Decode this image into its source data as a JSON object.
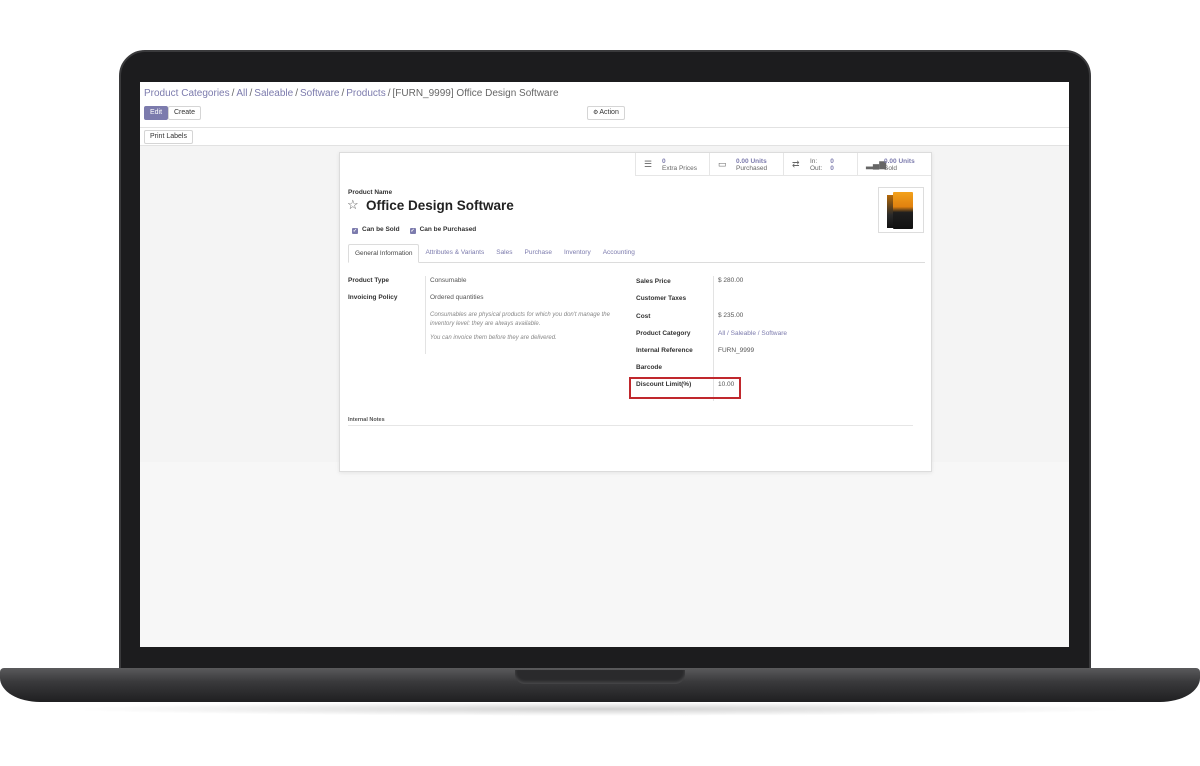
{
  "breadcrumb": {
    "items": [
      "Product Categories",
      "All",
      "Saleable",
      "Software",
      "Products"
    ],
    "separator": "/",
    "current": "[FURN_9999] Office Design Software"
  },
  "toolbar": {
    "edit_label": "Edit",
    "create_label": "Create",
    "action_label": "Action",
    "print_labels": "Print Labels"
  },
  "stat_buttons": {
    "extra_prices": {
      "value": "0",
      "label": "Extra Prices",
      "icon": "list-icon"
    },
    "purchased": {
      "value": "0.00 Units",
      "label": "Purchased",
      "icon": "credit-card-icon"
    },
    "in_out": {
      "in_label": "In:",
      "in_value": "0",
      "out_label": "Out:",
      "out_value": "0",
      "icon": "exchange-icon"
    },
    "sold": {
      "value": "0.00 Units",
      "label": "Sold",
      "icon": "signal-icon"
    }
  },
  "product": {
    "name_label": "Product Name",
    "name": "Office Design Software",
    "can_be_sold": "Can be Sold",
    "can_be_purchased": "Can be Purchased"
  },
  "tabs": [
    "General Information",
    "Attributes & Variants",
    "Sales",
    "Purchase",
    "Inventory",
    "Accounting"
  ],
  "left_fields": {
    "product_type_label": "Product Type",
    "product_type": "Consumable",
    "invoicing_policy_label": "Invoicing Policy",
    "invoicing_policy": "Ordered quantities",
    "help_1": "Consumables are physical products for which you don't manage the inventory level: they are always available.",
    "help_2": "You can invoice them before they are delivered."
  },
  "right_fields": {
    "sales_price_label": "Sales Price",
    "sales_price": "$ 280.00",
    "customer_taxes_label": "Customer Taxes",
    "cost_label": "Cost",
    "cost": "$ 235.00",
    "product_category_label": "Product Category",
    "product_category": "All / Saleable / Software",
    "internal_reference_label": "Internal Reference",
    "internal_reference": "FURN_9999",
    "barcode_label": "Barcode",
    "discount_limit_label": "Discount Limit(%)",
    "discount_limit": "10.00"
  },
  "internal_notes_label": "Internal Notes",
  "colors": {
    "accent": "#7c7bad",
    "highlight": "#c0282d"
  }
}
